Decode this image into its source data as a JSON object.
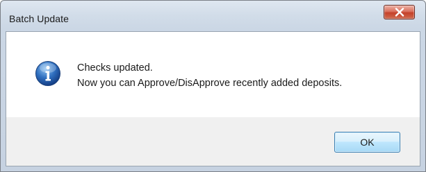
{
  "window": {
    "title": "Batch Update"
  },
  "message": {
    "line1": "Checks updated.",
    "line2": "Now you can Approve/DisApprove recently added deposits.",
    "icon": "info-icon"
  },
  "buttons": {
    "ok_label": "OK",
    "close_icon": "close-icon"
  },
  "colors": {
    "title_bar": "#cbd7e5",
    "close_button": "#c4412a",
    "info_icon": "#1f5aa6",
    "ok_button_border": "#3c7fb1",
    "button_bar": "#f0f0f0"
  }
}
